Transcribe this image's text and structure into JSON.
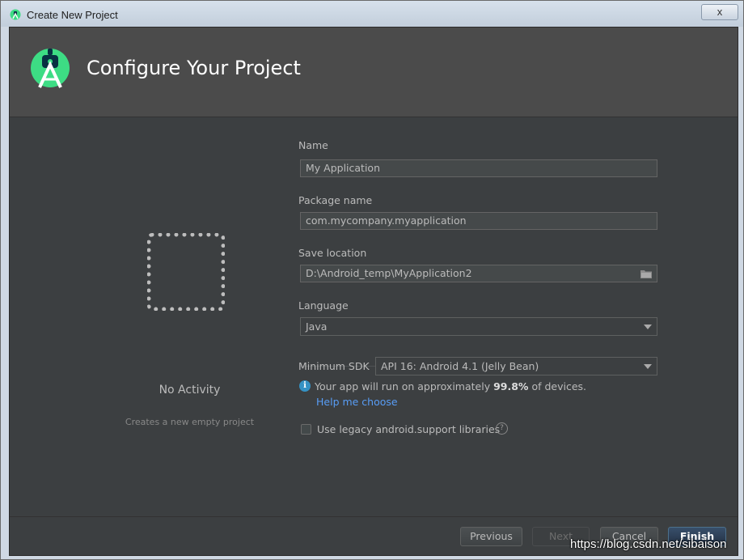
{
  "window": {
    "title": "Create New Project",
    "close_label": "x"
  },
  "header": {
    "heading": "Configure Your Project"
  },
  "template_preview": {
    "name": "No Activity",
    "description": "Creates a new empty project"
  },
  "form": {
    "name_label": "Name",
    "name_value": "My Application",
    "package_label": "Package name",
    "package_value": "com.mycompany.myapplication",
    "location_label": "Save location",
    "location_value": "D:\\Android_temp\\MyApplication2",
    "language_label": "Language",
    "language_value": "Java",
    "min_sdk_label": "Minimum SDK",
    "min_sdk_value": "API 16: Android 4.1 (Jelly Bean)",
    "info_prefix": "Your app will run on approximately",
    "info_percent": "99.8%",
    "info_suffix": "of devices.",
    "help_link": "Help me choose",
    "legacy_label": "Use legacy android.support libraries",
    "legacy_checked": false
  },
  "footer": {
    "previous": "Previous",
    "next": "Next",
    "cancel": "Cancel",
    "finish": "Finish"
  },
  "watermark": "https://blog.csdn.net/sibaison",
  "colors": {
    "background": "#3c3f41",
    "header": "#4b4b4b",
    "link": "#589df6",
    "logo_green": "#3ddc84"
  }
}
